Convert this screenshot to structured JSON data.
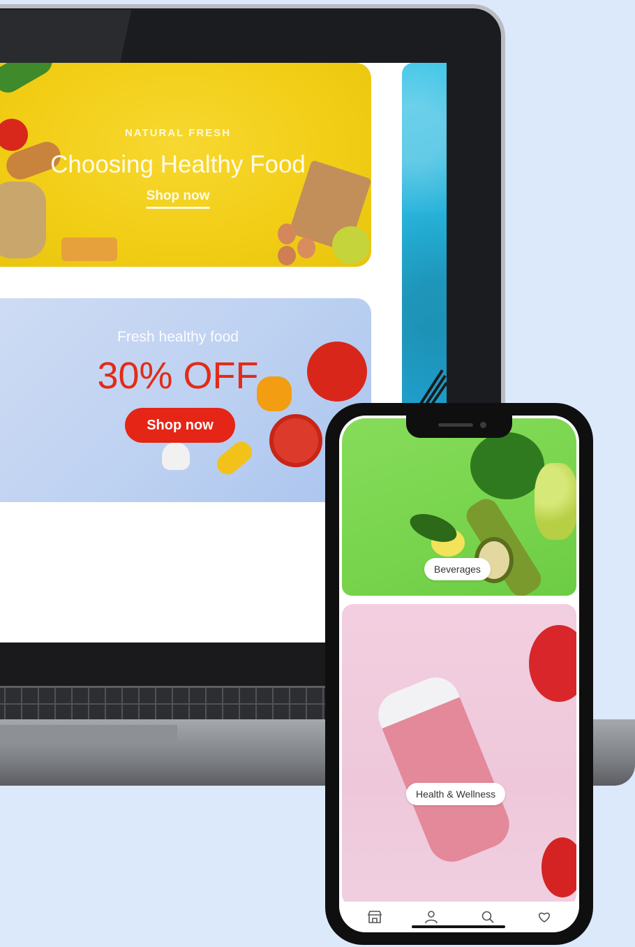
{
  "laptop": {
    "banner_one": {
      "eyebrow": "NATURAL FRESH",
      "headline": "Choosing Healthy Food",
      "cta": "Shop now"
    },
    "banner_two": {
      "subtitle": "Fresh healthy food",
      "discount": "30% OFF",
      "cta": "Shop now"
    }
  },
  "phone": {
    "categories": [
      {
        "label": "Beverages"
      },
      {
        "label": "Health & Wellness"
      }
    ],
    "tabbar": [
      {
        "icon": "store-icon"
      },
      {
        "icon": "profile-icon"
      },
      {
        "icon": "search-icon"
      },
      {
        "icon": "heart-icon"
      }
    ]
  },
  "colors": {
    "background": "#dbe9fb",
    "banner_yellow": "#f2cd15",
    "banner_blue": "#bdd1f1",
    "accent_red": "#e52516",
    "phone_green": "#78d44c",
    "phone_pink": "#eec8da"
  }
}
